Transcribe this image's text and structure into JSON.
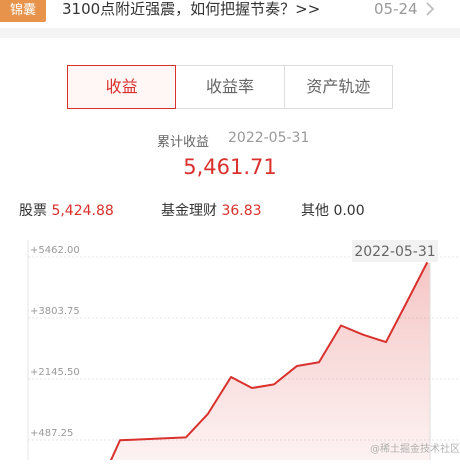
{
  "news": {
    "badge": "锦囊",
    "headline": "3100点附近强震，如何把握节奏？>>",
    "date": "05-24"
  },
  "tabs": [
    {
      "label": "收益",
      "active": true
    },
    {
      "label": "收益率",
      "active": false
    },
    {
      "label": "资产轨迹",
      "active": false
    }
  ],
  "summary": {
    "label": "累计收益",
    "date": "2022-05-31",
    "value": "5,461.71"
  },
  "breakdown": [
    {
      "label": "股票",
      "value": "5,424.88"
    },
    {
      "label": "基金理财",
      "value": "36.83"
    },
    {
      "label": "其他",
      "value": "0.00"
    }
  ],
  "colors": {
    "accent": "#d9312d",
    "badge": "#e7934c"
  },
  "chart_data": {
    "type": "area",
    "y_ticks": [
      "+5462.00",
      "+3803.75",
      "+2145.50",
      "+487.25"
    ],
    "y_tick_values": [
      5462.0,
      3803.75,
      2145.5,
      487.25
    ],
    "ylim": [
      -1000,
      5462.0
    ],
    "tooltip_date": "2022-05-31",
    "series": [
      {
        "values": [
          -600,
          480,
          530,
          560,
          1200,
          2200,
          1900,
          2000,
          2500,
          2600,
          3600,
          3350,
          3150,
          4300,
          4100,
          5462
        ]
      }
    ]
  },
  "watermark": "@稀土掘金技术社区"
}
